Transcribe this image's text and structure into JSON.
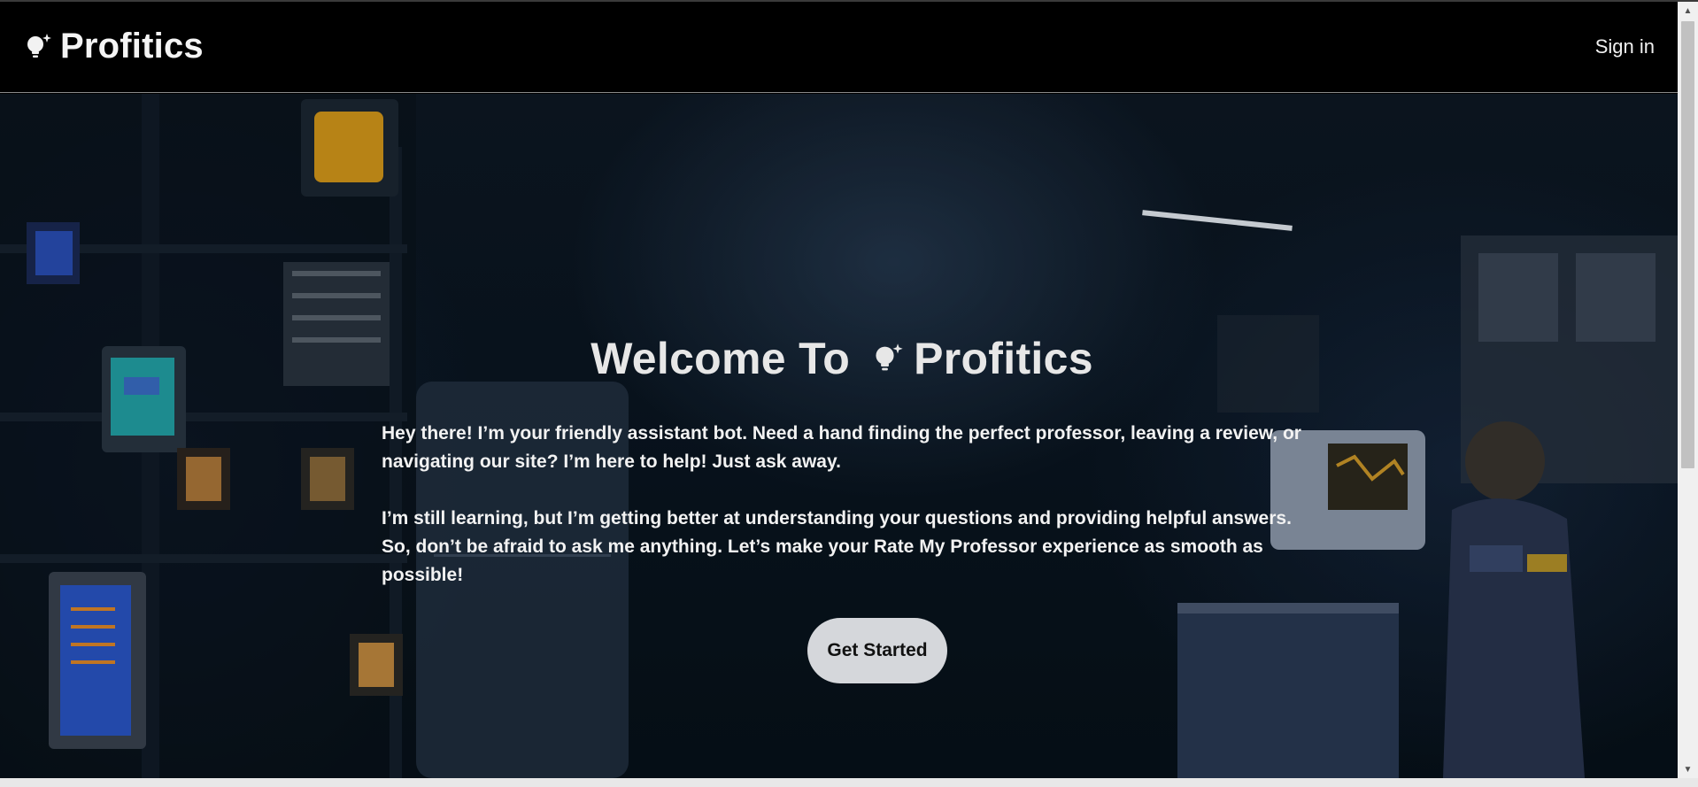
{
  "navbar": {
    "brand_name": "Profitics",
    "brand_icon": "lightbulb-sparkle-icon",
    "signin_label": "Sign in"
  },
  "hero": {
    "title_prefix": "Welcome To",
    "title_brand": "Profitics",
    "title_icon": "lightbulb-sparkle-icon",
    "paragraph_1": "Hey there! I’m your friendly assistant bot. Need a hand finding the perfect professor, leaving a review, or navigating our site? I’m here to help! Just ask away.",
    "paragraph_2": "I’m still learning, but I’m getting better at understanding your questions and providing helpful answers. So, don’t be afraid to ask me anything. Let’s make your Rate My Professor experience as smooth as possible!",
    "cta_label": "Get Started"
  },
  "colors": {
    "navbar_bg": "#000000",
    "cta_bg": "#d5d7db",
    "hero_bg": "#0a1622"
  }
}
